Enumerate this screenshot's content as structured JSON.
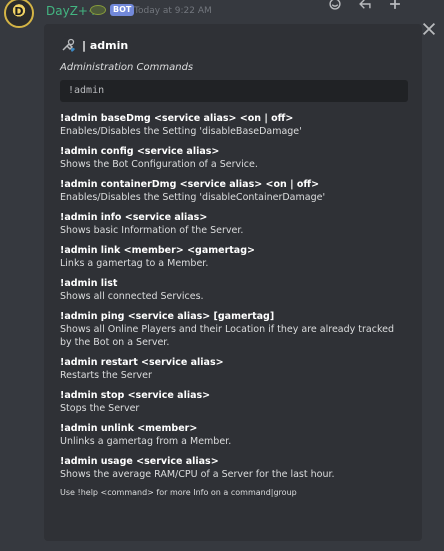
{
  "message": {
    "avatar_letter": "D",
    "username": "DayZ++",
    "bot_tag": "BOT",
    "timestamp": "Today at 9:22 AM"
  },
  "embed": {
    "author": "| admin",
    "description": "Administration Commands",
    "code": "!admin",
    "fields": [
      {
        "name": "!admin baseDmg <service alias> <on | off>",
        "value": "Enables/Disables the Setting 'disableBaseDamage'"
      },
      {
        "name": "!admin config <service alias>",
        "value": "Shows the Bot Configuration of a Service."
      },
      {
        "name": "!admin containerDmg <service alias> <on | off>",
        "value": "Enables/Disables the Setting 'disableContainerDamage'"
      },
      {
        "name": "!admin info <service alias>",
        "value": "Shows basic Information of the Server."
      },
      {
        "name": "!admin link <member> <gamertag>",
        "value": "Links a gamertag to a Member."
      },
      {
        "name": "!admin list",
        "value": "Shows all connected Services."
      },
      {
        "name": "!admin ping <service alias> [gamertag]",
        "value": "Shows all Online Players and their Location if they are already tracked by the Bot on a Server."
      },
      {
        "name": "!admin restart <service alias>",
        "value": "Restarts the Server"
      },
      {
        "name": "!admin stop <service alias>",
        "value": "Stops the Server"
      },
      {
        "name": "!admin unlink <member>",
        "value": "Unlinks a gamertag from a Member."
      },
      {
        "name": "!admin usage <service alias>",
        "value": "Shows the average RAM/CPU of a Server for the last hour."
      }
    ],
    "footer": "Use !help <command> for more Info on a command|group"
  },
  "icons": {
    "reaction": "emoji-icon",
    "reply": "reply-icon",
    "more": "more-icon",
    "close": "close-icon",
    "author": "tools-icon"
  },
  "colors": {
    "background": "#36393f",
    "embed": "#2f3136",
    "username": "#43b581",
    "bot_tag": "#7289da"
  }
}
